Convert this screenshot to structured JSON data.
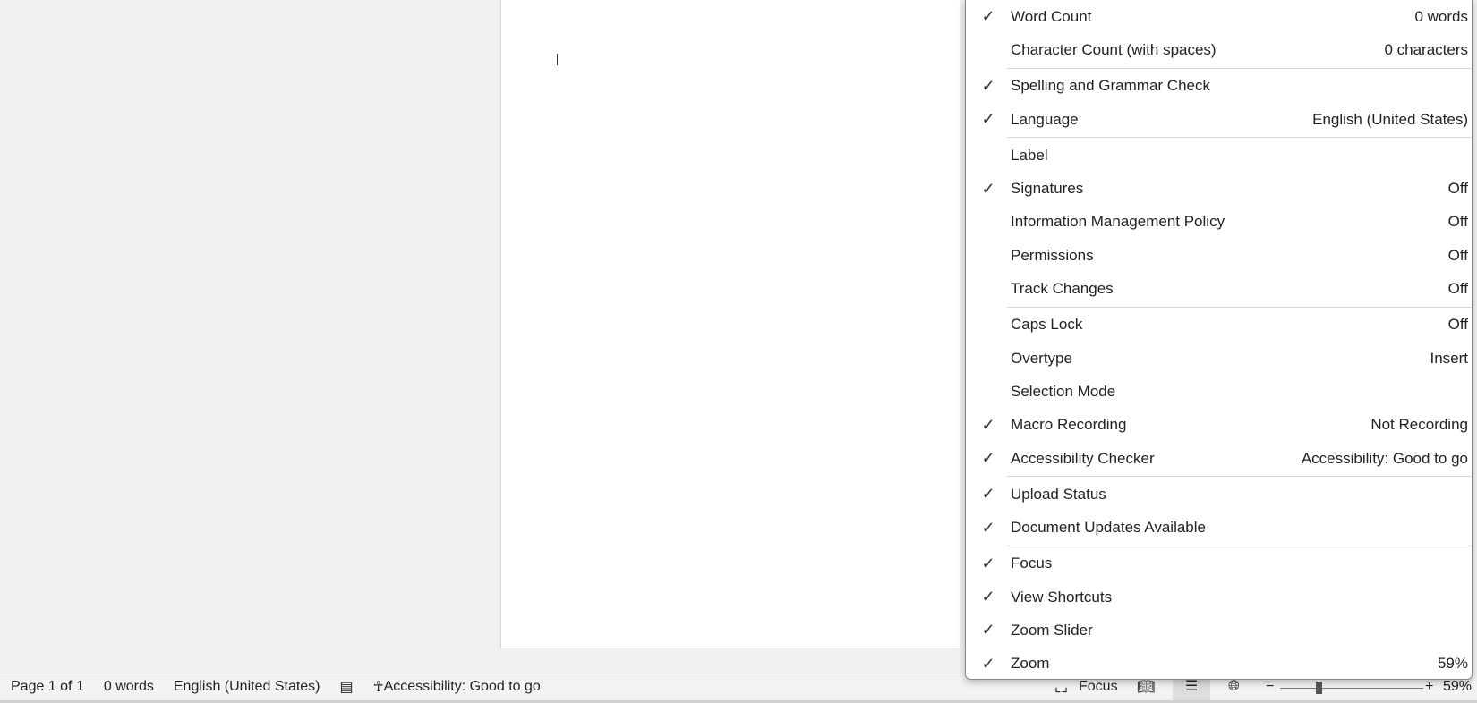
{
  "menu": {
    "items": [
      {
        "label": "Word Count",
        "value": "0 words",
        "checked": true
      },
      {
        "label": "Character Count (with spaces)",
        "value": "0 characters",
        "checked": false
      },
      {
        "label": "Spelling and Grammar Check",
        "value": "",
        "checked": true
      },
      {
        "label": "Language",
        "value": "English (United States)",
        "checked": true
      },
      {
        "label": "Label",
        "value": "",
        "checked": false
      },
      {
        "label": "Signatures",
        "value": "Off",
        "checked": true
      },
      {
        "label": "Information Management Policy",
        "value": "Off",
        "checked": false
      },
      {
        "label": "Permissions",
        "value": "Off",
        "checked": false
      },
      {
        "label": "Track Changes",
        "value": "Off",
        "checked": false
      },
      {
        "label": "Caps Lock",
        "value": "Off",
        "checked": false
      },
      {
        "label": "Overtype",
        "value": "Insert",
        "checked": false
      },
      {
        "label": "Selection Mode",
        "value": "",
        "checked": false
      },
      {
        "label": "Macro Recording",
        "value": "Not Recording",
        "checked": true
      },
      {
        "label": "Accessibility Checker",
        "value": "Accessibility: Good to go",
        "checked": true
      },
      {
        "label": "Upload Status",
        "value": "",
        "checked": true
      },
      {
        "label": "Document Updates Available",
        "value": "",
        "checked": true
      },
      {
        "label": "Focus",
        "value": "",
        "checked": true
      },
      {
        "label": "View Shortcuts",
        "value": "",
        "checked": true
      },
      {
        "label": "Zoom Slider",
        "value": "",
        "checked": true
      },
      {
        "label": "Zoom",
        "value": "59%",
        "checked": true
      }
    ],
    "check_glyph": "✓"
  },
  "status": {
    "page": "Page 1 of 1",
    "words": "0 words",
    "language": "English (United States)",
    "accessibility": "Accessibility: Good to go",
    "focus": "Focus",
    "zoom": "59%",
    "zoom_minus": "−",
    "zoom_plus": "+",
    "zoom_percent": 59
  }
}
